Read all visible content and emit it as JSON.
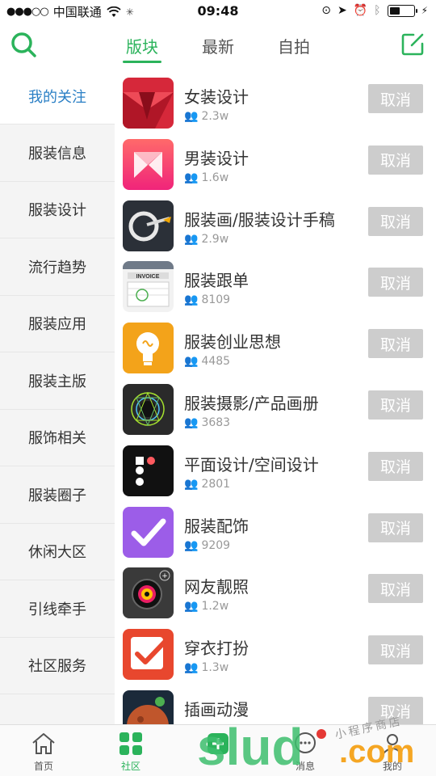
{
  "status_bar": {
    "carrier": "中国联通",
    "signal": "●●●○○",
    "time": "09:48"
  },
  "header": {
    "tabs": [
      {
        "label": "版块",
        "active": true
      },
      {
        "label": "最新",
        "active": false
      },
      {
        "label": "自拍",
        "active": false
      }
    ],
    "accent_color": "#2bb35b"
  },
  "sidebar": {
    "items": [
      {
        "label": "我的关注",
        "active": true
      },
      {
        "label": "服装信息"
      },
      {
        "label": "服装设计"
      },
      {
        "label": "流行趋势"
      },
      {
        "label": "服装应用"
      },
      {
        "label": "服装主版"
      },
      {
        "label": "服饰相关"
      },
      {
        "label": "服装圈子"
      },
      {
        "label": "休闲大区"
      },
      {
        "label": "引线牵手"
      },
      {
        "label": "社区服务"
      }
    ]
  },
  "list": {
    "items": [
      {
        "title": "女装设计",
        "members": "2.3w",
        "action": "取消",
        "icon": "red-fold-icon"
      },
      {
        "title": "男装设计",
        "members": "1.6w",
        "action": "取消",
        "icon": "pink-m-icon"
      },
      {
        "title": "服装画/服装设计手稿",
        "members": "2.9w",
        "action": "取消",
        "icon": "pen-tool-icon"
      },
      {
        "title": "服装跟单",
        "members": "8109",
        "action": "取消",
        "icon": "invoice-icon"
      },
      {
        "title": "服装创业思想",
        "members": "4485",
        "action": "取消",
        "icon": "lightbulb-icon"
      },
      {
        "title": "服装摄影/产品画册",
        "members": "3683",
        "action": "取消",
        "icon": "spirograph-icon"
      },
      {
        "title": "平面设计/空间设计",
        "members": "2801",
        "action": "取消",
        "icon": "dots-icon"
      },
      {
        "title": "服装配饰",
        "members": "9209",
        "action": "取消",
        "icon": "checkmark-purple-icon"
      },
      {
        "title": "网友靓照",
        "members": "1.2w",
        "action": "取消",
        "icon": "camera-lens-icon"
      },
      {
        "title": "穿衣打扮",
        "members": "1.3w",
        "action": "取消",
        "icon": "checkmark-red-icon"
      },
      {
        "title": "插画动漫",
        "members": "",
        "action": "取消",
        "icon": "planet-icon"
      }
    ]
  },
  "bottom_nav": {
    "items": [
      {
        "label": "首页",
        "icon": "home-icon"
      },
      {
        "label": "社区",
        "icon": "grid-icon",
        "active": true
      },
      {
        "label": "",
        "icon": "center-icon"
      },
      {
        "label": "消息",
        "icon": "message-icon"
      },
      {
        "label": "我的",
        "icon": "profile-icon"
      }
    ]
  },
  "watermark": {
    "brand": "slud",
    "suffix": ".com",
    "tagline": "小程序商店"
  }
}
